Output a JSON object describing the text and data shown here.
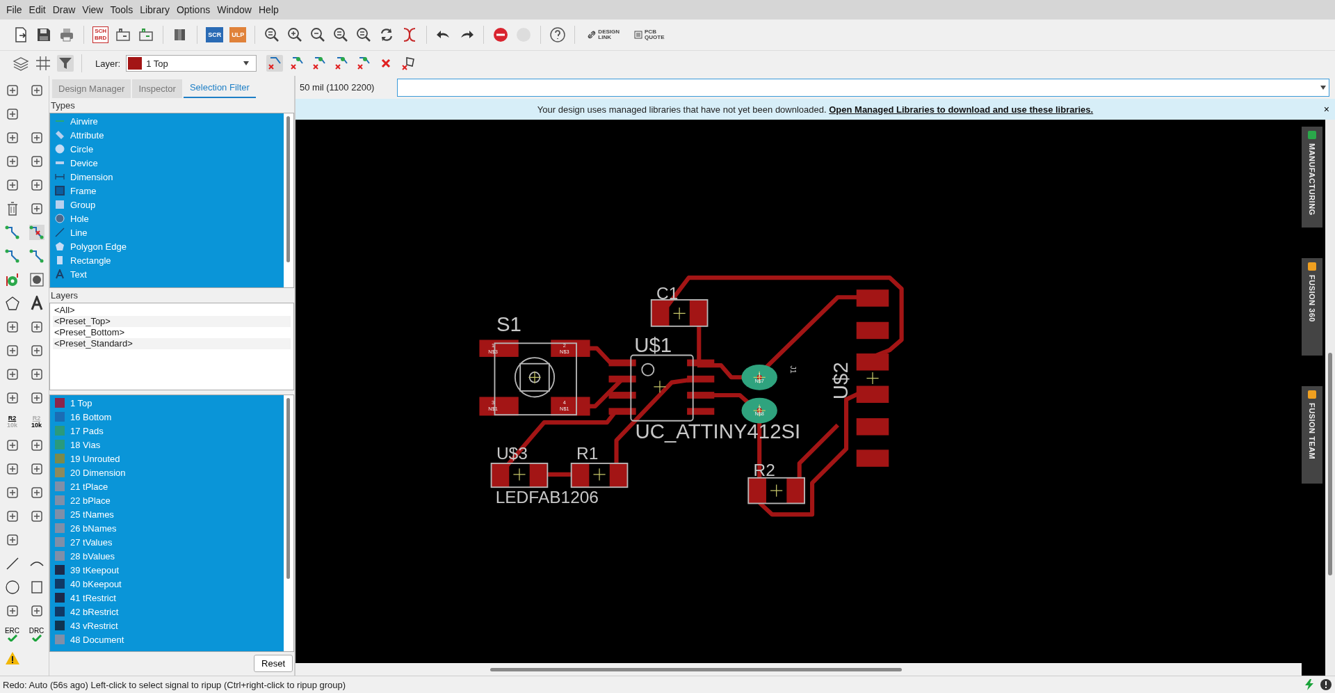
{
  "menu": [
    "File",
    "Edit",
    "Draw",
    "View",
    "Tools",
    "Library",
    "Options",
    "Window",
    "Help"
  ],
  "toolbar": {
    "sch_brd": [
      "SCH",
      "BRD"
    ],
    "scr": "SCR",
    "ulp": "ULP",
    "design_link": [
      "DESIGN",
      "LINK"
    ],
    "pcb_quote": [
      "PCB",
      "QUOTE"
    ]
  },
  "layer_bar": {
    "label": "Layer:",
    "layer": {
      "name": "1 Top",
      "color": "#a31515"
    }
  },
  "tools": {
    "r2_values": [
      "R2",
      "10k",
      "R2",
      "10k"
    ],
    "erc": "ERC",
    "drc": "DRC"
  },
  "tabs": [
    {
      "label": "Design Manager",
      "selected": false
    },
    {
      "label": "Inspector",
      "selected": false
    },
    {
      "label": "Selection Filter",
      "selected": true
    }
  ],
  "types": {
    "title": "Types",
    "items": [
      {
        "label": "Airwire",
        "selected": true
      },
      {
        "label": "Attribute",
        "selected": true
      },
      {
        "label": "Circle",
        "selected": true
      },
      {
        "label": "Device",
        "selected": true
      },
      {
        "label": "Dimension",
        "selected": true
      },
      {
        "label": "Frame",
        "selected": true
      },
      {
        "label": "Group",
        "selected": true
      },
      {
        "label": "Hole",
        "selected": true
      },
      {
        "label": "Line",
        "selected": true
      },
      {
        "label": "Polygon Edge",
        "selected": true
      },
      {
        "label": "Rectangle",
        "selected": true
      },
      {
        "label": "Text",
        "selected": true
      }
    ]
  },
  "layers": {
    "title": "Layers",
    "presets": [
      "<All>",
      "<Preset_Top>",
      "<Preset_Bottom>",
      "<Preset_Standard>"
    ],
    "items": [
      {
        "label": "1 Top",
        "color": "#8c2449",
        "selected": true
      },
      {
        "label": "16 Bottom",
        "color": "#1a6db5",
        "selected": true
      },
      {
        "label": "17 Pads",
        "color": "#2a9a7c",
        "selected": true
      },
      {
        "label": "18 Vias",
        "color": "#2a9a7c",
        "selected": true
      },
      {
        "label": "19 Unrouted",
        "color": "#7a8a4c",
        "selected": true
      },
      {
        "label": "20 Dimension",
        "color": "#8e8a5c",
        "selected": true
      },
      {
        "label": "21 tPlace",
        "color": "#7f8fa8",
        "selected": true
      },
      {
        "label": "22 bPlace",
        "color": "#7f8fa8",
        "selected": true
      },
      {
        "label": "25 tNames",
        "color": "#7f8fa8",
        "selected": true
      },
      {
        "label": "26 bNames",
        "color": "#7f8fa8",
        "selected": true
      },
      {
        "label": "27 tValues",
        "color": "#7f8fa8",
        "selected": true
      },
      {
        "label": "28 bValues",
        "color": "#7f8fa8",
        "selected": true
      },
      {
        "label": "39 tKeepout",
        "color": "#1c2a4a",
        "selected": true
      },
      {
        "label": "40 bKeepout",
        "color": "#103a66",
        "selected": true
      },
      {
        "label": "41 tRestrict",
        "color": "#1c2a4a",
        "selected": true
      },
      {
        "label": "42 bRestrict",
        "color": "#103a66",
        "selected": true
      },
      {
        "label": "43 vRestrict",
        "color": "#0f3550",
        "selected": true
      },
      {
        "label": "48 Document",
        "color": "#7f8fa8",
        "selected": true
      }
    ],
    "reset": "Reset"
  },
  "coordinates": "50 mil (1100 2200)",
  "banner": {
    "text": "Your design uses managed libraries that have not yet been downloaded.",
    "link": "Open Managed Libraries to download and use these libraries.",
    "close": "×"
  },
  "board": {
    "names": [
      "S1",
      "C1",
      "U$1",
      "UC_ATTINY412SI",
      "U$3",
      "R1",
      "LEDFAB1206",
      "R2",
      "U$2",
      "J1"
    ],
    "pads": [
      {
        "number": "1",
        "net": "N$3"
      },
      {
        "number": "2",
        "net": "N$3"
      },
      {
        "number": "3",
        "net": "N$1"
      },
      {
        "number": "4",
        "net": "N$1"
      },
      {
        "number": "1",
        "net": "N$7"
      },
      {
        "number": "2",
        "net": "N$8"
      }
    ]
  },
  "side_tabs": [
    "MANUFACTURING",
    "FUSION 360",
    "FUSION TEAM"
  ],
  "status": "Redo: Auto (56s ago) Left-click to select signal to ripup (Ctrl+right-click to ripup group)"
}
